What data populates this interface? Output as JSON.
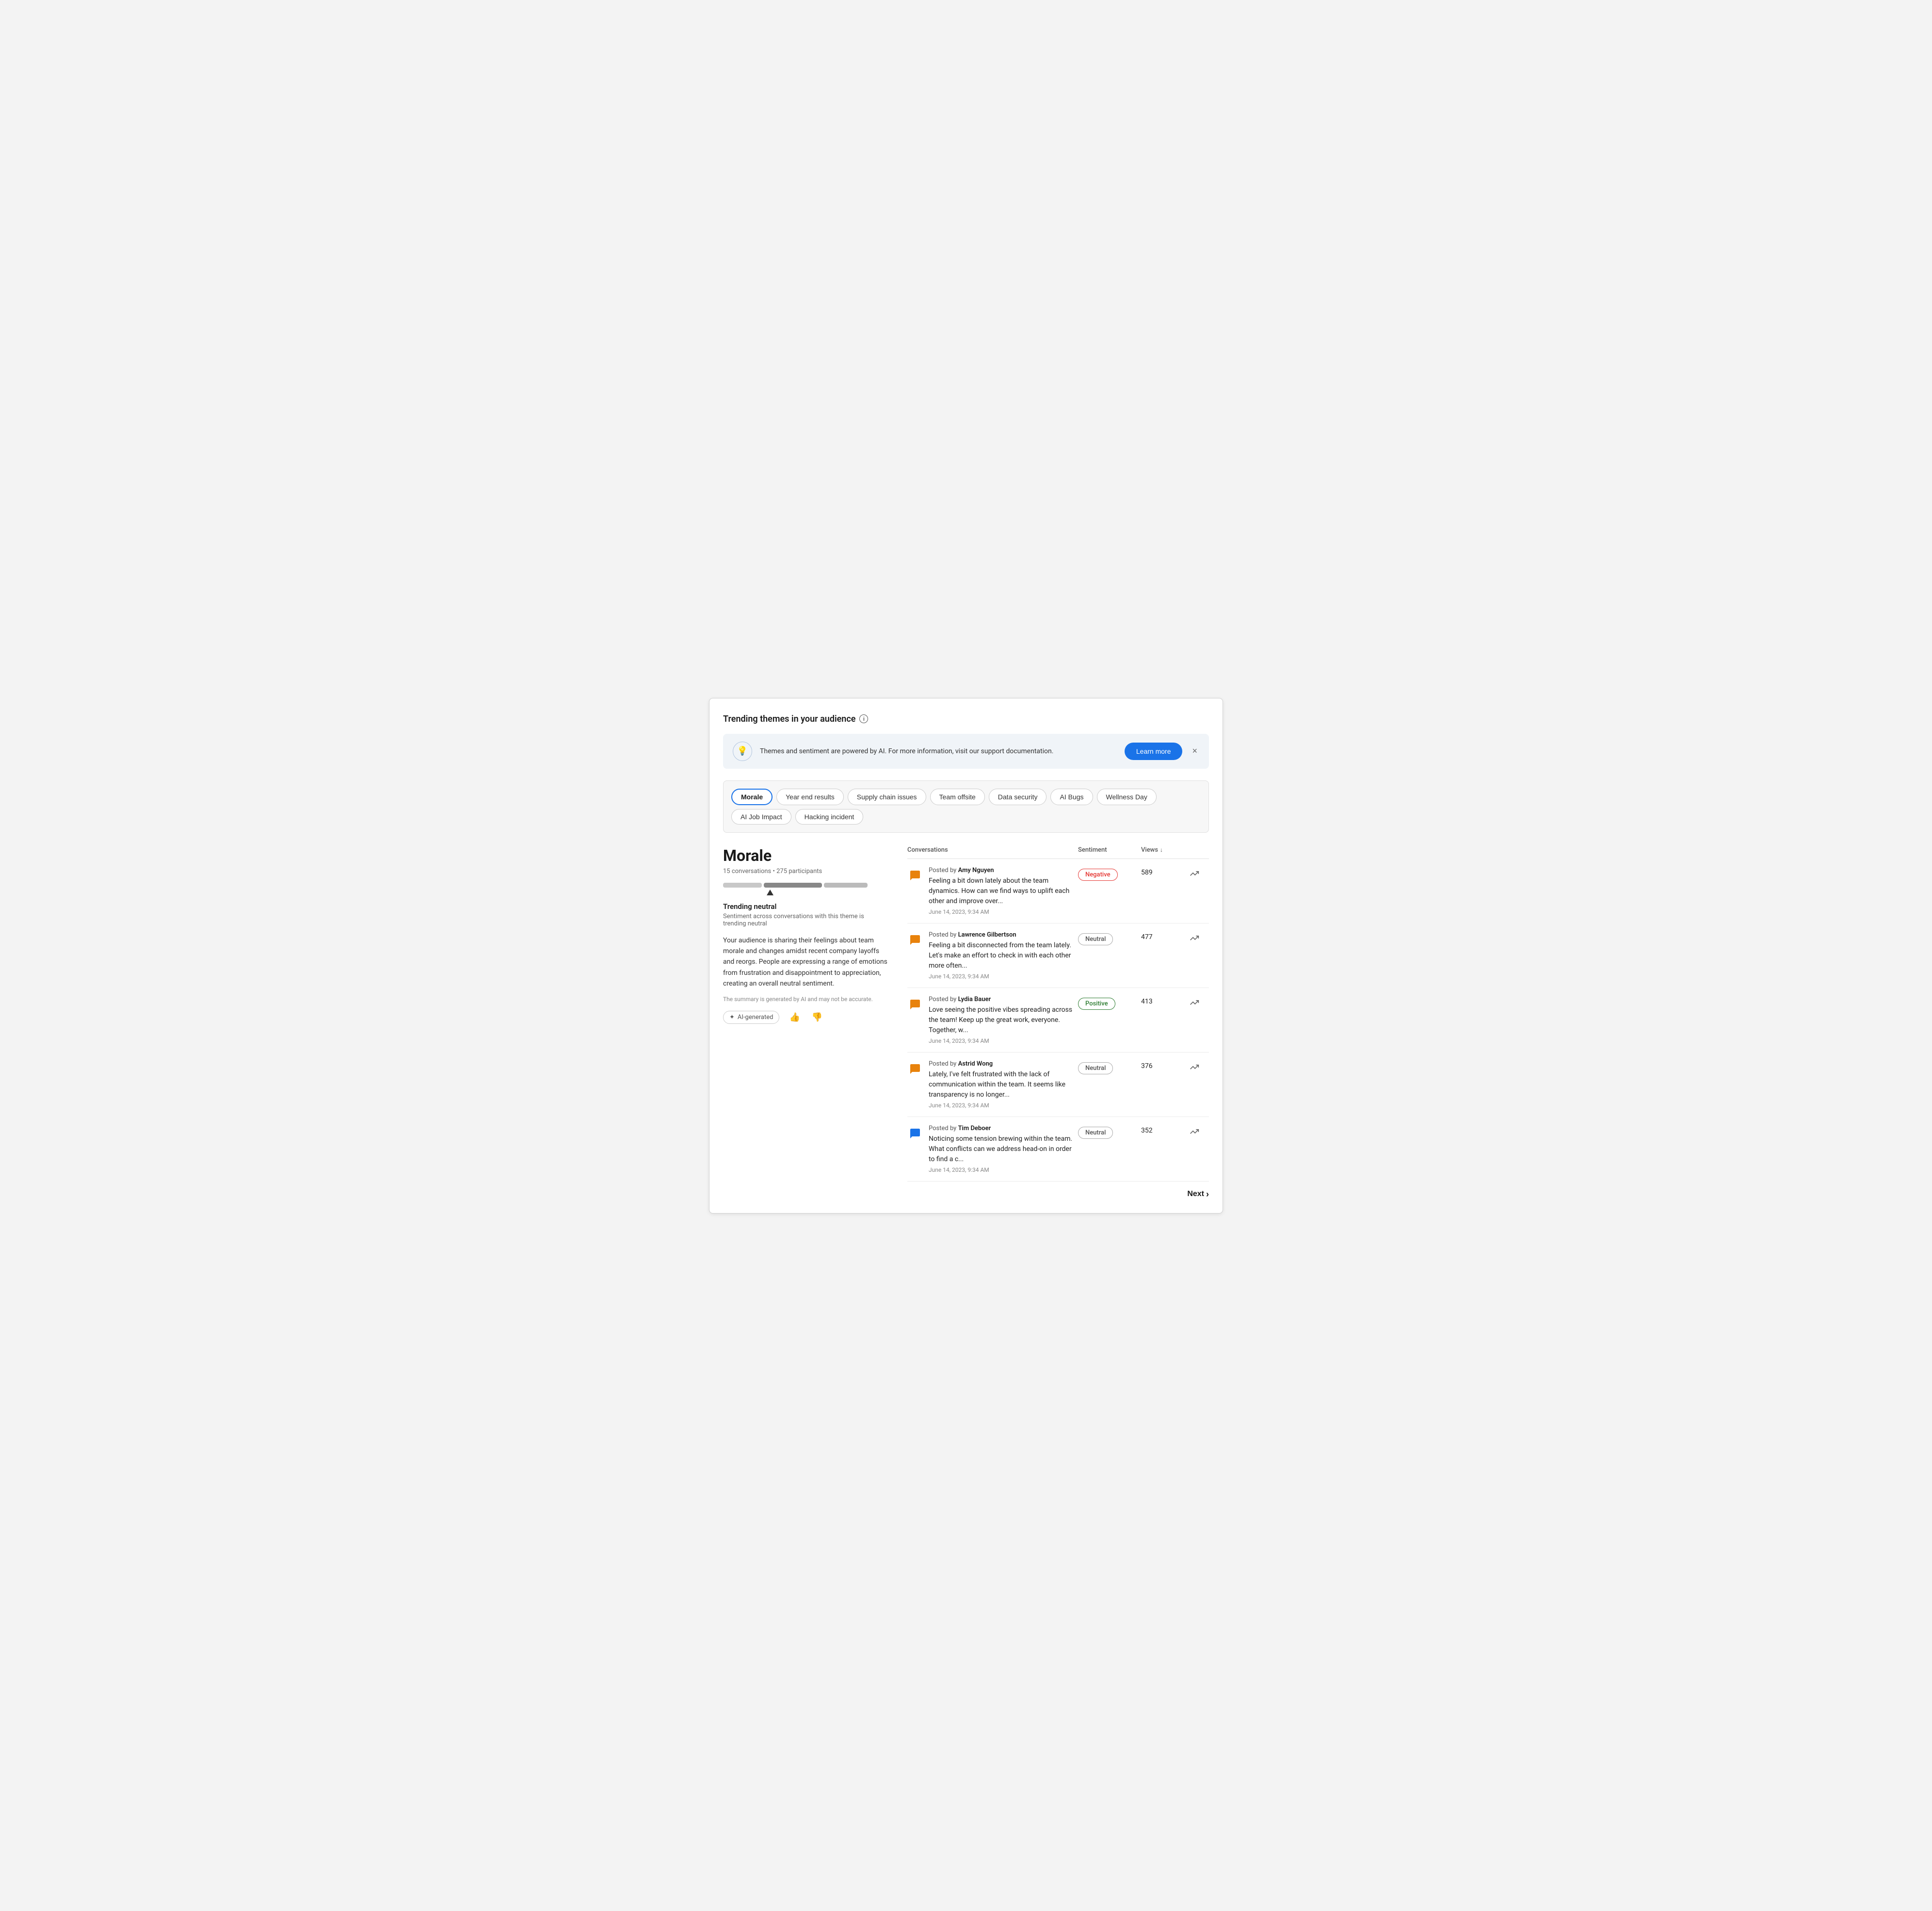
{
  "page": {
    "title": "Trending themes in your audience",
    "info_label": "i"
  },
  "banner": {
    "text": "Themes and sentiment are powered by AI. For more information, visit our support documentation.",
    "learn_more": "Learn more",
    "close_label": "×",
    "icon": "💡"
  },
  "themes": {
    "chips": [
      {
        "label": "Morale",
        "active": true
      },
      {
        "label": "Year end results",
        "active": false
      },
      {
        "label": "Supply chain issues",
        "active": false
      },
      {
        "label": "Team offsite",
        "active": false
      },
      {
        "label": "Data security",
        "active": false
      },
      {
        "label": "AI Bugs",
        "active": false
      },
      {
        "label": "Wellness Day",
        "active": false
      },
      {
        "label": "AI Job Impact",
        "active": false
      },
      {
        "label": "Hacking incident",
        "active": false
      }
    ]
  },
  "detail": {
    "theme_name": "Morale",
    "meta": "15 conversations • 275 participants",
    "trending_label": "Trending neutral",
    "trending_sub": "Sentiment across conversations with this theme is trending neutral",
    "description": "Your audience is sharing their feelings about team morale and changes amidst recent company layoffs and reorgs. People are expressing a range of emotions from frustration and disappointment to appreciation, creating an overall neutral sentiment.",
    "ai_disclaimer": "The summary is generated by AI and may not be accurate.",
    "ai_badge": "AI-generated",
    "thumbs_up": "👍",
    "thumbs_down": "👎"
  },
  "table": {
    "columns": {
      "conversations": "Conversations",
      "sentiment": "Sentiment",
      "views": "Views",
      "sort_arrow": "↓"
    },
    "rows": [
      {
        "author": "Amy Nguyen",
        "body": "Feeling a bit down lately about the team dynamics. How can we find ways to uplift each other and improve over...",
        "date": "June 14, 2023, 9:34 AM",
        "sentiment": "Negative",
        "sentiment_type": "negative",
        "views": "589",
        "icon_type": "orange"
      },
      {
        "author": "Lawrence Gilbertson",
        "body": "Feeling a bit disconnected from the team lately. Let's make an effort to check in with each other more often...",
        "date": "June 14, 2023, 9:34 AM",
        "sentiment": "Neutral",
        "sentiment_type": "neutral",
        "views": "477",
        "icon_type": "orange"
      },
      {
        "author": "Lydia Bauer",
        "body": "Love seeing the positive vibes spreading across the team! Keep up the great work, everyone. Together, w...",
        "date": "June 14, 2023, 9:34 AM",
        "sentiment": "Positive",
        "sentiment_type": "positive",
        "views": "413",
        "icon_type": "orange"
      },
      {
        "author": "Astrid Wong",
        "body": "Lately, I've felt frustrated with the lack of communication within the team. It seems like transparency is no longer...",
        "date": "June 14, 2023, 9:34 AM",
        "sentiment": "Neutral",
        "sentiment_type": "neutral",
        "views": "376",
        "icon_type": "orange"
      },
      {
        "author": "Tim Deboer",
        "body": "Noticing some tension brewing within the team. What conflicts can we address head-on in order to find a c...",
        "date": "June 14, 2023, 9:34 AM",
        "sentiment": "Neutral",
        "sentiment_type": "neutral",
        "views": "352",
        "icon_type": "blue"
      }
    ]
  },
  "pagination": {
    "next_label": "Next"
  }
}
